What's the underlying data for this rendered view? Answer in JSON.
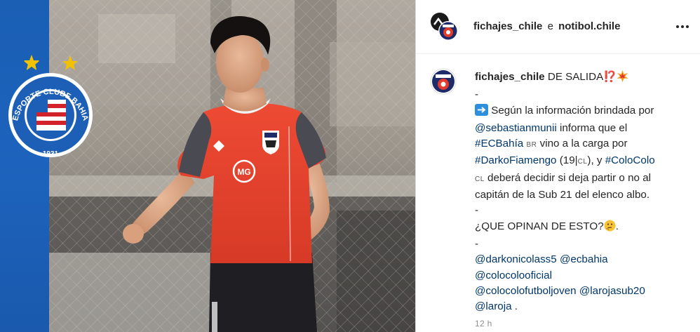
{
  "header": {
    "user1": "fichajes_chile",
    "connector": "e",
    "user2": "notibol.chile",
    "more_icon": "more-horizontal-icon"
  },
  "media": {
    "crest_text_top": "ESPORTE CLUBE BAHIA",
    "crest_year": "1931",
    "shirt_sponsor": "MG",
    "shirt_brand": "umbro",
    "colors": {
      "blue_band": "#1a5fb4",
      "shirt": "#e8432e",
      "shirt_sleeve": "#4a4a52",
      "shorts": "#1e1e22",
      "star": "#f2c200"
    }
  },
  "post": {
    "author": "fichajes_chile",
    "headline": "DE SALIDA⁉️",
    "dash": "-",
    "arrow_icon": "right-arrow-emoji",
    "line1": "Según la información brindada por",
    "mention_sebastian": "@sebastianmunii",
    "line2_rest": " informa que el",
    "tag_ecbahia": "#ECBahía",
    "br_code": "BR",
    "line3_rest": " vino a la carga por",
    "tag_darko": "#DarkoFiamengo",
    "darko_suffix": " (19|",
    "cl_code": "CL",
    "darko_suffix2": "), y ",
    "tag_colocolo": "#ColoColo",
    "cl_code2": "CL",
    "line5_rest": " deberá decidir si deja partir o no al",
    "line6": "capitán de la Sub 21 del elenco albo.",
    "question": "¿QUE OPINAN DE ESTO?",
    "period": ".",
    "mention_darko": "@darkonicolass5",
    "mention_ecbahia": "@ecbahia",
    "mention_colocolooficial": "@colocolooficial",
    "mention_colocolojoven": "@colocolofutboljoven",
    "mention_larojasub20": "@larojasub20",
    "mention_laroja": "@laroja",
    "end_period": " .",
    "time": "12 h"
  }
}
